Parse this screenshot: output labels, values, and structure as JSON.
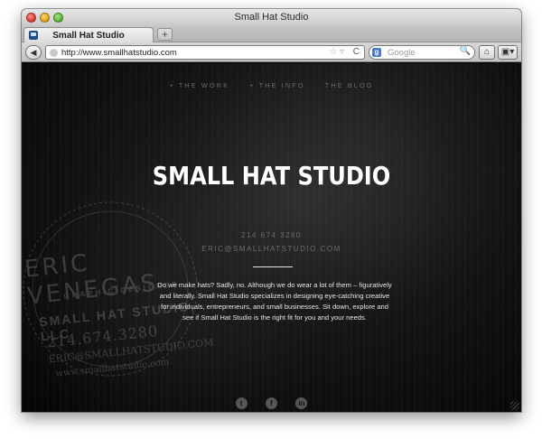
{
  "browser": {
    "window_title": "Small Hat Studio",
    "tab_title": "Small Hat Studio",
    "new_tab_label": "+",
    "url": "http://www.smallhatstudio.com",
    "search_placeholder": "Google",
    "search_engine_label": "g",
    "back_label": "◀",
    "star_label": "☆ ▿",
    "reload_label": "C",
    "search_icon_label": "🔍",
    "home_label": "⌂",
    "bookmark_label": "▣▾"
  },
  "site": {
    "nav": [
      "+ THE WORK",
      "+ THE INFO",
      "THE BLOG"
    ],
    "title": "SMALL HAT STUDIO",
    "phone": "214 674 3280",
    "email": "ERIC@SMALLHATSTUDIO.COM",
    "description": "Do we make hats? Sadly, no. Although we do wear a lot of them – figuratively and literally. Small Hat Studio specializes in designing eye-catching creative for individuals, entrepreneurs, and small businesses. Sit down, explore and see if Small Hat Studio is the right fit for you and your needs.",
    "card": {
      "name": "ERIC VENEGAS",
      "role": "GRAPHIC DESIGNER",
      "company": "SMALL HAT STUDIO, LLC",
      "phone": "214.674.3280",
      "email": "ERIC@SMALLHATSTUDIO.COM",
      "web": "www.smallhatstudio.com"
    },
    "social": [
      {
        "name": "twitter",
        "glyph": "t"
      },
      {
        "name": "facebook",
        "glyph": "f"
      },
      {
        "name": "linkedin",
        "glyph": "in"
      }
    ]
  }
}
